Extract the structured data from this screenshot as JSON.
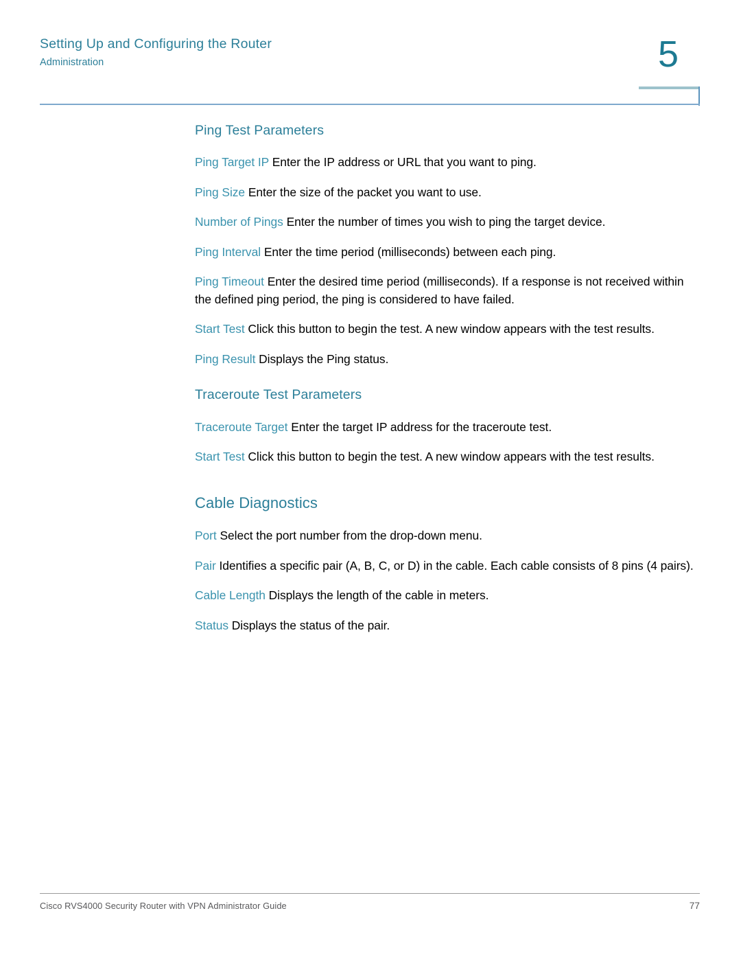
{
  "header": {
    "chapter_title": "Setting Up and Configuring the Router",
    "section_title": "Administration",
    "chapter_number": "5"
  },
  "sections": [
    {
      "id": "ping-test-parameters",
      "level": "h3",
      "heading": "Ping Test Parameters",
      "items": [
        {
          "term": "Ping Target IP",
          "description": " Enter the IP address or URL that you want to ping."
        },
        {
          "term": "Ping Size",
          "description": " Enter the size of the packet you want to use."
        },
        {
          "term": "Number of Pings",
          "description": " Enter the number of times you wish to ping the target device."
        },
        {
          "term": "Ping Interval",
          "description": " Enter the time period (milliseconds) between each ping."
        },
        {
          "term": "Ping Timeout",
          "description": " Enter the desired time period (milliseconds). If a response is not received within the defined ping period, the ping is considered to have failed."
        },
        {
          "term": "Start Test",
          "description": " Click this button to begin the test. A new window appears with the test results."
        },
        {
          "term": "Ping Result",
          "description": " Displays the Ping status."
        }
      ]
    },
    {
      "id": "traceroute-test-parameters",
      "level": "h3",
      "heading": "Traceroute Test Parameters",
      "items": [
        {
          "term": "Traceroute Target",
          "description": " Enter the target IP address for the traceroute test."
        },
        {
          "term": "Start Test",
          "description": " Click this button to begin the test. A new window appears with the test results."
        }
      ]
    },
    {
      "id": "cable-diagnostics",
      "level": "h2",
      "heading": "Cable Diagnostics",
      "items": [
        {
          "term": "Port",
          "description": " Select the port number from the drop-down menu."
        },
        {
          "term": "Pair",
          "description": " Identifies a specific pair (A, B, C, or D) in the cable. Each cable consists of 8 pins (4 pairs)."
        },
        {
          "term": "Cable Length",
          "description": " Displays the length of the cable in meters."
        },
        {
          "term": "Status",
          "description": " Displays the status of the pair."
        }
      ]
    }
  ],
  "footer": {
    "guide_title": "Cisco RVS4000 Security Router with VPN Administrator Guide",
    "page_number": "77"
  },
  "colors": {
    "heading_teal": "#2c7f99",
    "term_blue": "#3b93ae",
    "chapter_number_teal": "#1d7a92",
    "header_rule_blue": "#7fa9cd",
    "chapter_box_top": "#9dc2cc",
    "footer_gray": "#58585a",
    "body_black": "#000000"
  }
}
